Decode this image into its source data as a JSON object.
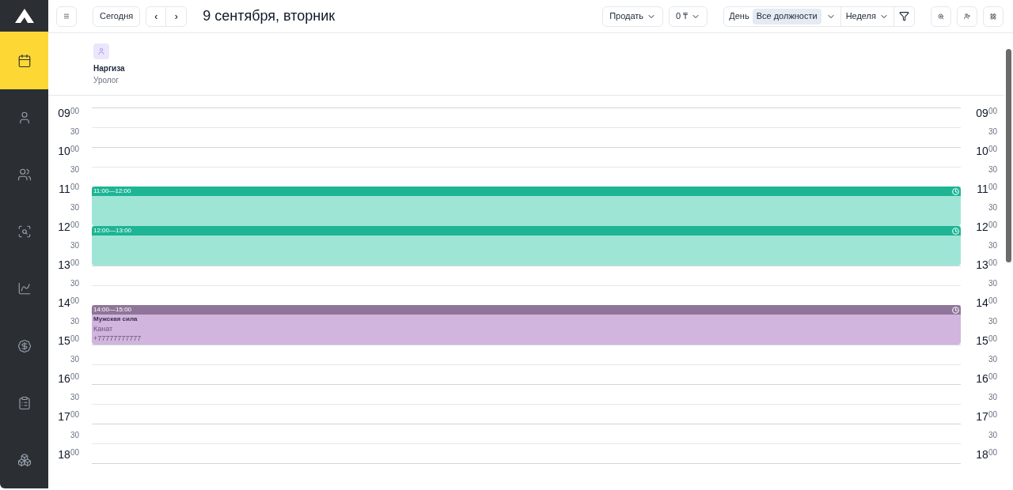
{
  "sidebar": {
    "items": [
      {
        "selected": true
      },
      {
        "selected": false
      },
      {
        "selected": false
      },
      {
        "selected": false
      },
      {
        "selected": false
      },
      {
        "selected": false
      },
      {
        "selected": false
      },
      {
        "selected": false
      }
    ]
  },
  "toolbar": {
    "today": "Сегодня",
    "prev": "‹",
    "next": "›",
    "date": "9 сентября, вторник",
    "sell": "Продать",
    "balance": "0 ₸",
    "view_label": "День",
    "position_filter": "Все должности",
    "period": "Неделя"
  },
  "staff": [
    {
      "name": "Наргиза",
      "role": "Уролог"
    }
  ],
  "slots": [
    {
      "kind": "hour",
      "left": {
        "hour": "09",
        "minute": "00"
      },
      "right": {
        "hour": "09",
        "minute": "00"
      }
    },
    {
      "kind": "half",
      "left": {
        "minute": "30"
      },
      "right": {
        "minute": "30"
      }
    },
    {
      "kind": "hour",
      "left": {
        "hour": "10",
        "minute": "00"
      },
      "right": {
        "hour": "10",
        "minute": "00"
      }
    },
    {
      "kind": "half",
      "left": {
        "minute": "30"
      },
      "right": {
        "minute": "30"
      }
    },
    {
      "kind": "hour",
      "left": {
        "hour": "11",
        "minute": "00"
      },
      "right": {
        "hour": "11",
        "minute": "00"
      },
      "event": {
        "time": "11:00—12:00",
        "color": "#1db594"
      }
    },
    {
      "kind": "half",
      "left": {
        "minute": "30"
      },
      "right": {
        "minute": "30"
      }
    },
    {
      "kind": "hour",
      "left": {
        "hour": "12",
        "minute": "00"
      },
      "right": {
        "hour": "12",
        "minute": "00"
      },
      "event": {
        "time": "12:00—13:00",
        "color": "#1db594"
      }
    },
    {
      "kind": "half",
      "left": {
        "minute": "30"
      },
      "right": {
        "minute": "30"
      }
    },
    {
      "kind": "hour",
      "left": {
        "hour": "13",
        "minute": "00"
      },
      "right": {
        "hour": "13",
        "minute": "00"
      }
    },
    {
      "kind": "half",
      "left": {
        "minute": "30"
      },
      "right": {
        "minute": "30"
      }
    },
    {
      "kind": "hour",
      "left": {
        "hour": "14",
        "minute": "00"
      },
      "right": {
        "hour": "14",
        "minute": "00"
      },
      "event": {
        "time": "14:00—15:00",
        "color": "#8f7599",
        "service": "Мужская сила",
        "client": "Канат",
        "phone": "+77777777777"
      }
    },
    {
      "kind": "half",
      "left": {
        "minute": "30"
      },
      "right": {
        "minute": "30"
      }
    },
    {
      "kind": "hour",
      "left": {
        "hour": "15",
        "minute": "00"
      },
      "right": {
        "hour": "15",
        "minute": "00"
      }
    },
    {
      "kind": "half",
      "left": {
        "minute": "30"
      },
      "right": {
        "minute": "30"
      }
    },
    {
      "kind": "hour",
      "left": {
        "hour": "16",
        "minute": "00"
      },
      "right": {
        "hour": "16",
        "minute": "00"
      }
    },
    {
      "kind": "half",
      "left": {
        "minute": "30"
      },
      "right": {
        "minute": "30"
      }
    },
    {
      "kind": "hour",
      "left": {
        "hour": "17",
        "minute": "00"
      },
      "right": {
        "hour": "17",
        "minute": "00"
      }
    },
    {
      "kind": "half",
      "left": {
        "minute": "30"
      },
      "right": {
        "minute": "30"
      }
    },
    {
      "kind": "hour",
      "left": {
        "hour": "18",
        "minute": "00"
      },
      "right": {
        "hour": "18",
        "minute": "00"
      }
    }
  ]
}
